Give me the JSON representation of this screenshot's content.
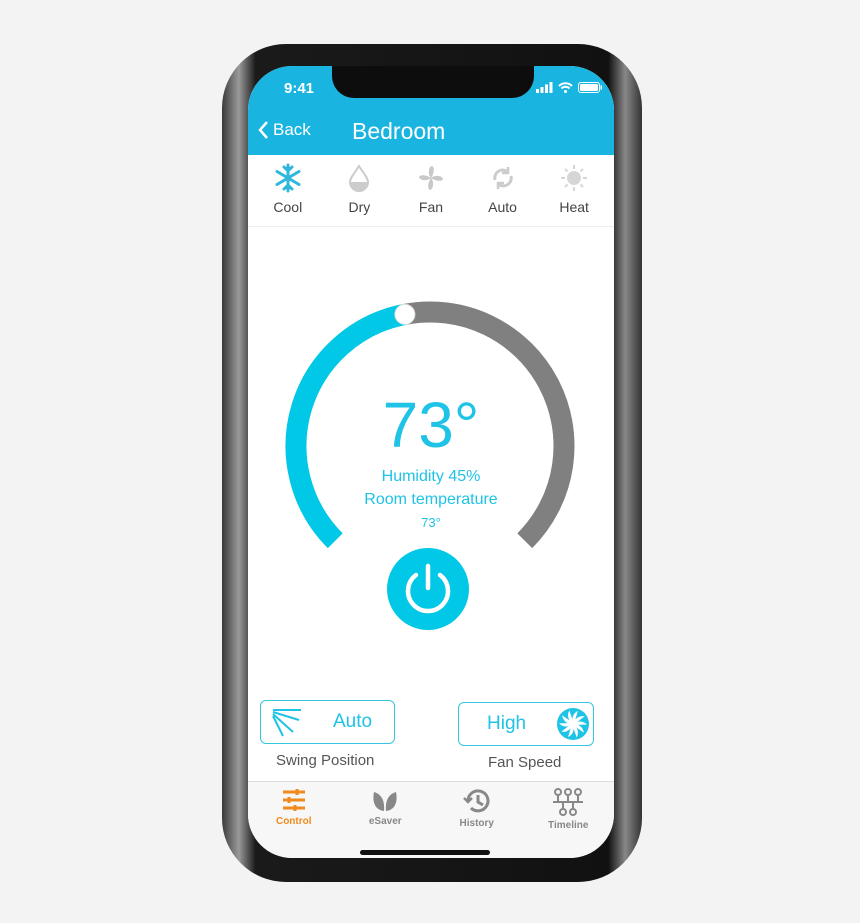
{
  "status_bar": {
    "time": "9:41"
  },
  "header": {
    "back_label": "Back",
    "title": "Bedroom"
  },
  "modes": [
    {
      "label": "Cool",
      "icon": "snowflake-icon",
      "active": true
    },
    {
      "label": "Dry",
      "icon": "droplet-icon"
    },
    {
      "label": "Fan",
      "icon": "fan-icon"
    },
    {
      "label": "Auto",
      "icon": "refresh-icon"
    },
    {
      "label": "Heat",
      "icon": "sun-icon"
    }
  ],
  "thermostat": {
    "setpoint": "73°",
    "humidity": "Humidity 45%",
    "room_label": "Room temperature",
    "room_value": "73°",
    "level_fraction": 0.46
  },
  "swing": {
    "value": "Auto",
    "label": "Swing Position"
  },
  "fan_speed": {
    "value": "High",
    "label": "Fan Speed"
  },
  "tabs": [
    {
      "label": "Control",
      "active": true
    },
    {
      "label": "eSaver"
    },
    {
      "label": "History"
    },
    {
      "label": "Timeline"
    }
  ],
  "colors": {
    "header": "#1ab4e0",
    "accent": "#1ec3e6",
    "track": "#808080",
    "active_tab": "#f08a1c"
  }
}
